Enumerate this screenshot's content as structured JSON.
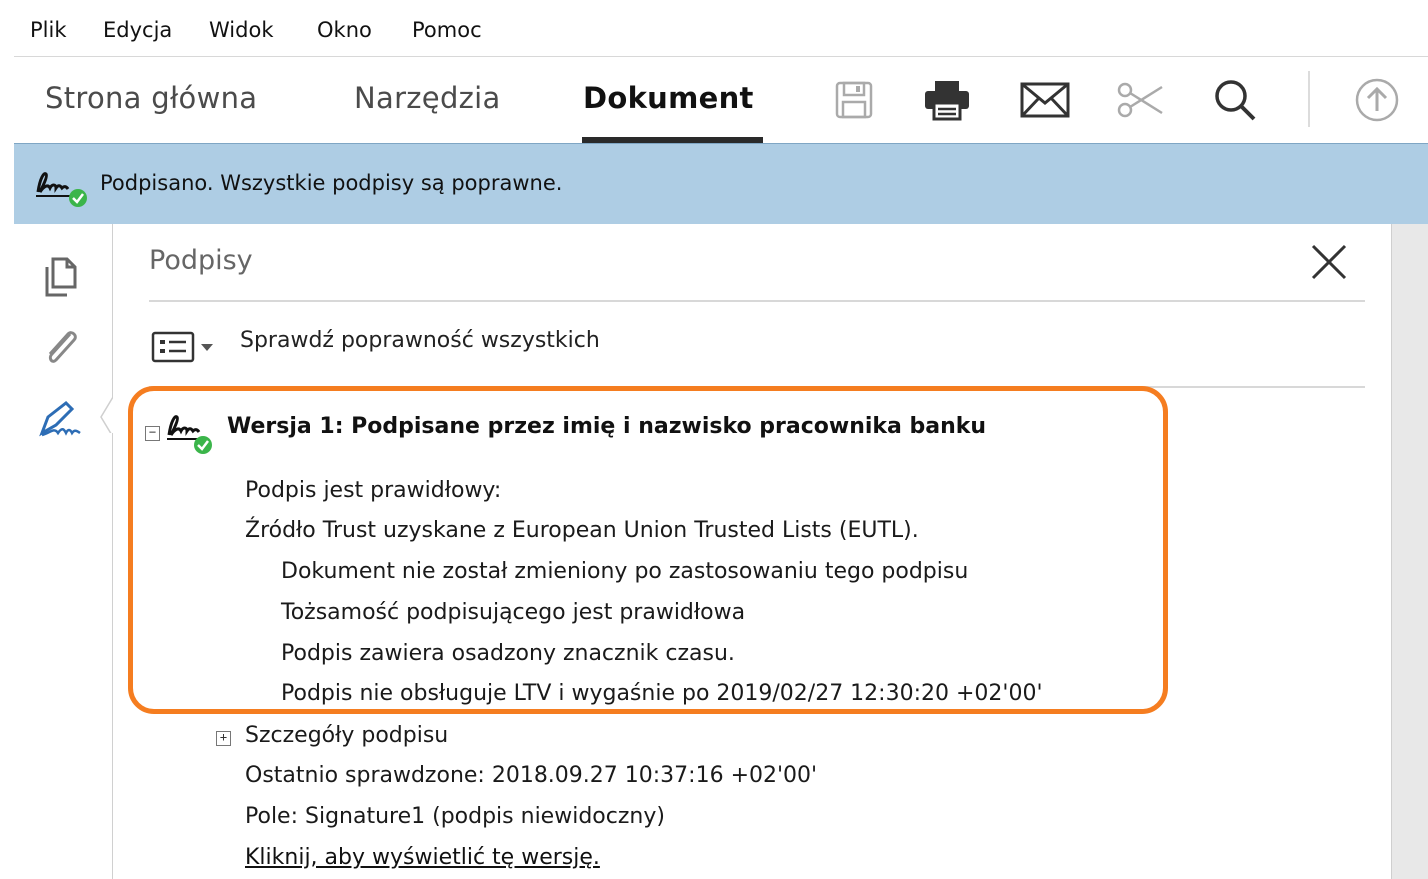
{
  "menu": [
    "Plik",
    "Edycja",
    "Widok",
    "Okno",
    "Pomoc"
  ],
  "tabs": [
    {
      "label": "Strona główna",
      "active": false
    },
    {
      "label": "Narzędzia",
      "active": false
    },
    {
      "label": "Dokument",
      "active": true
    }
  ],
  "toolbar_icons": [
    "save-icon",
    "print-icon",
    "mail-icon",
    "scissors-icon",
    "search-icon",
    "upload-icon"
  ],
  "banner": {
    "text": "Podpisano. Wszystkie podpisy są poprawne."
  },
  "rail_icons": [
    "pages-icon",
    "attachment-icon",
    "signature-icon"
  ],
  "panel": {
    "title": "Podpisy",
    "validate_all": "Sprawdź poprawność wszystkich",
    "version": {
      "title": "Wersja 1: Podpisane przez  imię i nazwisko pracownika banku",
      "lines": [
        "Podpis jest prawidłowy:",
        "Źródło Trust uzyskane z European Union Trusted Lists (EUTL).",
        "Dokument nie został zmieniony po zastosowaniu tego podpisu",
        "Tożsamość podpisującego jest prawidłowa",
        "Podpis zawiera osadzony znacznik czasu.",
        "Podpis nie obsługuje LTV i wygaśnie po 2019/02/27 12:30:20 +02'00'"
      ]
    },
    "details_label": "Szczegóły podpisu",
    "last_checked": "Ostatnio sprawdzone: 2018.09.27 10:37:16 +02'00'",
    "field": "Pole: Signature1 (podpis niewidoczny)",
    "view_version_link": "Kliknij, aby wyświetlić tę wersję."
  },
  "colors": {
    "banner": "#aecde4",
    "highlight": "#f57d20",
    "check": "#3bb54a"
  }
}
